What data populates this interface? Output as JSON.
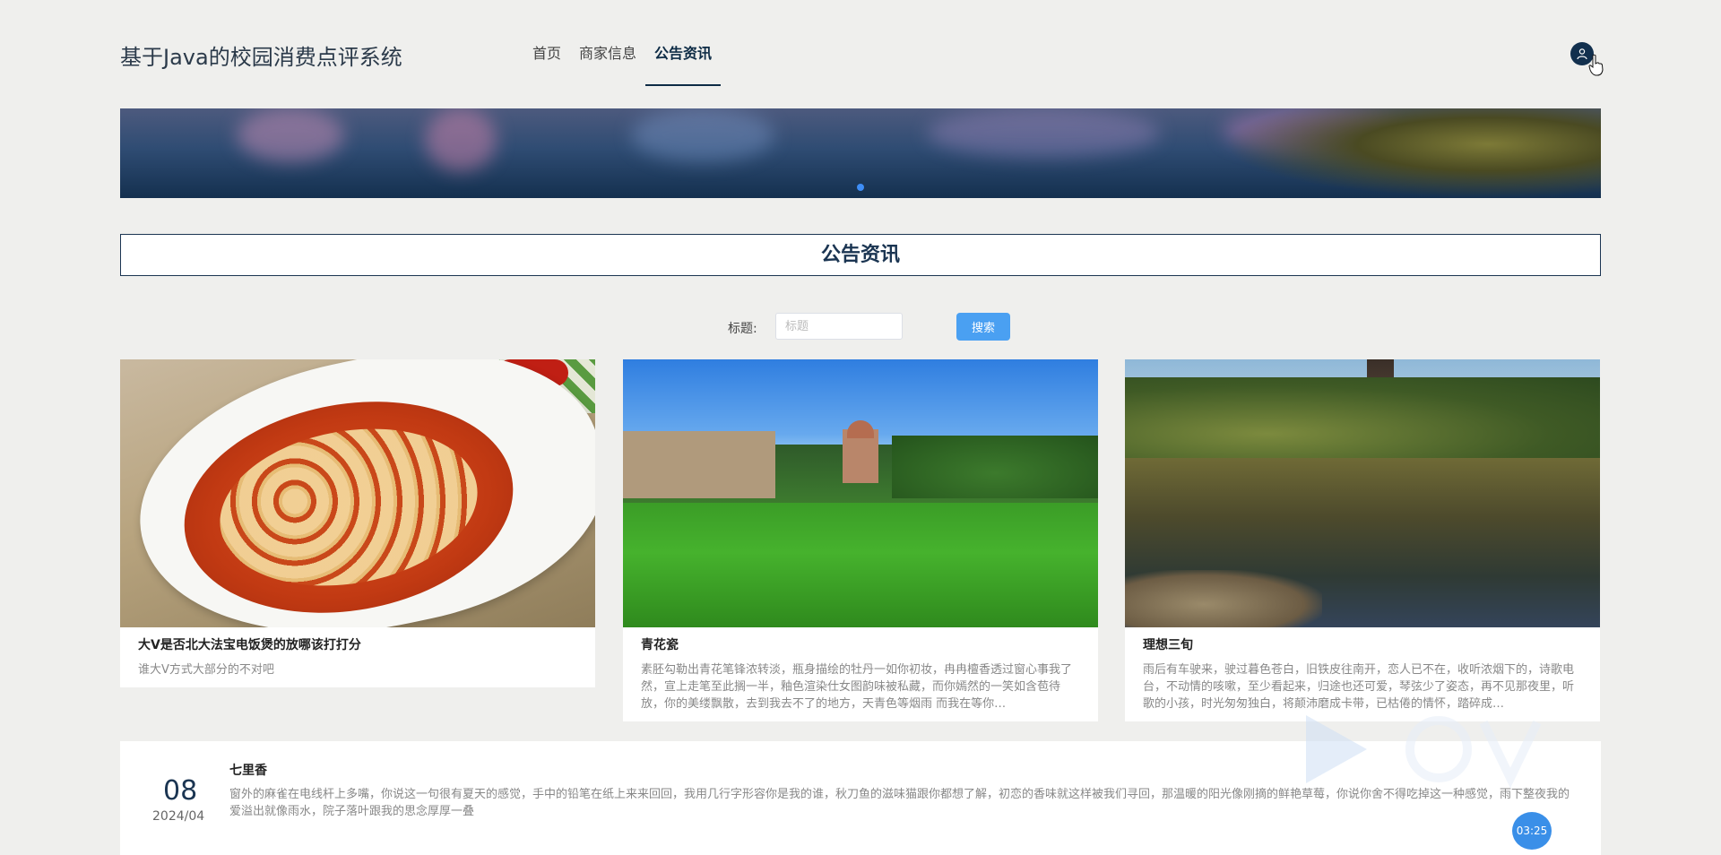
{
  "header": {
    "site_title": "基于Java的校园消费点评系统",
    "nav": [
      {
        "label": "首页",
        "active": false
      },
      {
        "label": "商家信息",
        "active": false
      },
      {
        "label": "公告资讯",
        "active": true
      }
    ],
    "user_icon": "user-icon"
  },
  "banner": {
    "active_slide": 1,
    "slide_count": 1
  },
  "section": {
    "title": "公告资讯"
  },
  "search": {
    "label": "标题:",
    "placeholder": "标题",
    "value": "",
    "button_label": "搜索"
  },
  "cards": [
    {
      "title": "大V是否北大法宝电饭煲的放哪该打打分",
      "desc": "谁大V方式大部分的不对吧",
      "image": "mapo-tofu"
    },
    {
      "title": "青花瓷",
      "desc": "素胚勾勒出青花笔锋浓转淡，瓶身描绘的牡丹一如你初妆，冉冉檀香透过窗心事我了然，宣上走笔至此搁一半，釉色渲染仕女图韵味被私藏，而你嫣然的一笑如含苞待放，你的美缕飘散，去到我去不了的地方，天青色等烟雨 而我在等你…",
      "image": "campus-lawn"
    },
    {
      "title": "理想三旬",
      "desc": "雨后有车驶来，驶过暮色苍白，旧铁皮往南开，恋人已不在，收听浓烟下的，诗歌电台，不动情的咳嗽，至少看起来，归途也还可爱，琴弦少了姿态，再不见那夜里，听歌的小孩，时光匆匆独白，将颠沛磨成卡带，已枯倦的情怀，踏碎成…",
      "image": "lake-pagoda"
    }
  ],
  "news": [
    {
      "day": "08",
      "year_month": "2024/04",
      "title": "七里香",
      "desc": "窗外的麻雀在电线杆上多嘴，你说这一句很有夏天的感觉，手中的铅笔在纸上来来回回，我用几行字形容你是我的谁，秋刀鱼的滋味猫跟你都想了解，初恋的香味就这样被我们寻回，那温暖的阳光像刚摘的鲜艳草莓，你说你舍不得吃掉这一种感觉，雨下整夜我的爱溢出就像雨水，院子落叶跟我的思念厚厚一叠"
    }
  ],
  "timer": "03:25",
  "colors": {
    "accent": "#1b3552",
    "button": "#4aa0f2",
    "background": "#efefed"
  }
}
